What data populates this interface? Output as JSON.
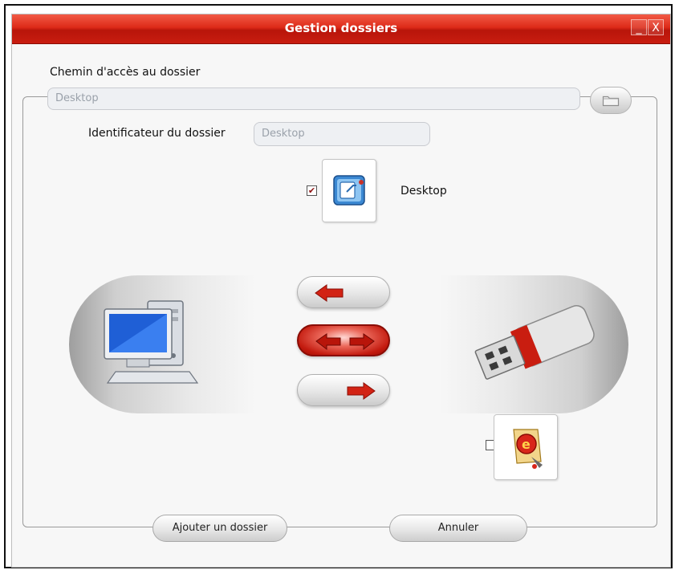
{
  "window": {
    "title": "Gestion dossiers",
    "minimize_glyph": "_",
    "close_glyph": "X",
    "accent_color": "#d32414"
  },
  "path_section": {
    "label": "Chemin d'accès au dossier",
    "path_value": "Desktop",
    "browse_icon": "folder-icon"
  },
  "identifier_section": {
    "label": "Identificateur du dossier",
    "value": "Desktop"
  },
  "folder_item": {
    "name": "Desktop",
    "checked": true,
    "icon": "desktop-shortcut-icon"
  },
  "computer_side": {
    "icon": "computer-icon"
  },
  "usb_side": {
    "icon": "usb-drive-icon"
  },
  "sync_options": [
    {
      "icon": "arrow-left-icon",
      "selected": false
    },
    {
      "icon": "arrow-both-icon",
      "selected": true
    },
    {
      "icon": "arrow-right-icon",
      "selected": false
    }
  ],
  "usb_item": {
    "checked": false,
    "icon": "usb-app-icon"
  },
  "buttons": {
    "add_folder": "Ajouter un dossier",
    "cancel": "Annuler"
  }
}
